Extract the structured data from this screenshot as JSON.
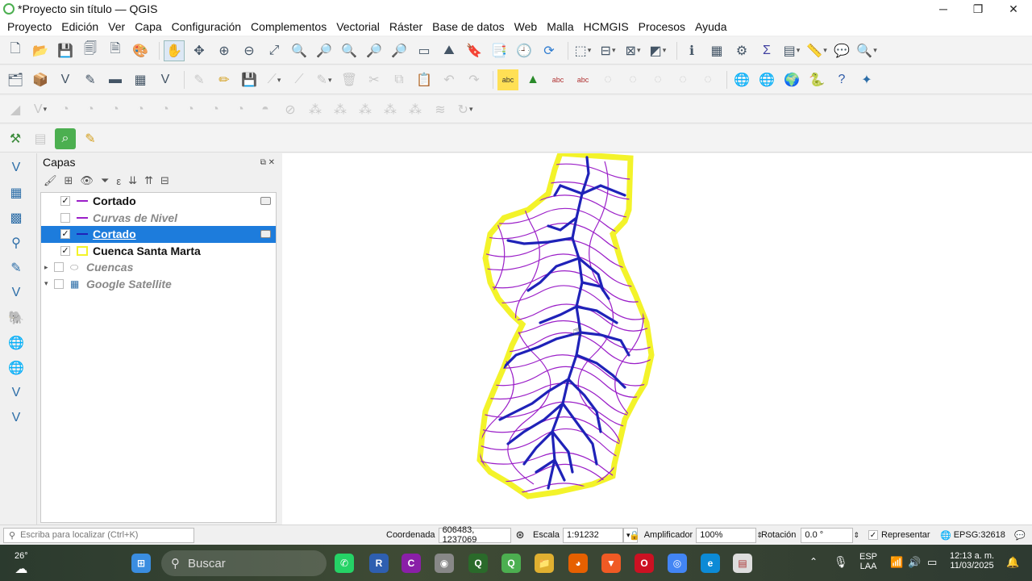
{
  "window": {
    "title": "*Proyecto sin título — QGIS"
  },
  "menu": [
    "Proyecto",
    "Edición",
    "Ver",
    "Capa",
    "Configuración",
    "Complementos",
    "Vectorial",
    "Ráster",
    "Base de datos",
    "Web",
    "Malla",
    "HCMGIS",
    "Procesos",
    "Ayuda"
  ],
  "layers_panel": {
    "title": "Capas",
    "items": [
      {
        "name": "Cortado",
        "checked": "✓",
        "symbol": "line-purple"
      },
      {
        "name": "Curvas de Nivel",
        "checked": "",
        "symbol": "line-purple"
      },
      {
        "name": "Cortado",
        "checked": "✓",
        "symbol": "line-blue",
        "selected": true
      },
      {
        "name": "Cuenca Santa Marta",
        "checked": "✓",
        "symbol": "polygon-yellow"
      },
      {
        "name": "Cuencas",
        "checked": "",
        "symbol": "group"
      },
      {
        "name": "Google Satellite",
        "checked": "",
        "symbol": "raster"
      }
    ]
  },
  "status": {
    "locator_placeholder": "Escriba para localizar (Ctrl+K)",
    "coord_label": "Coordenada",
    "coord_value": "606483, 1237069",
    "scale_label": "Escala",
    "scale_value": "1:91232",
    "magnifier_label": "Amplificador",
    "magnifier_value": "100%",
    "rotation_label": "Rotación",
    "rotation_value": "0.0 °",
    "render_label": "Representar",
    "crs": "EPSG:32618"
  },
  "taskbar": {
    "weather": "26°",
    "search": "Buscar",
    "lang": "ESP",
    "lang2": "LAA",
    "time": "12:13 a. m.",
    "date": "11/03/2025"
  },
  "colors": {
    "contours": "#9b1fc8",
    "streams": "#1f22b8",
    "boundary": "#f3f32a",
    "selection": "#1d7cdc"
  }
}
